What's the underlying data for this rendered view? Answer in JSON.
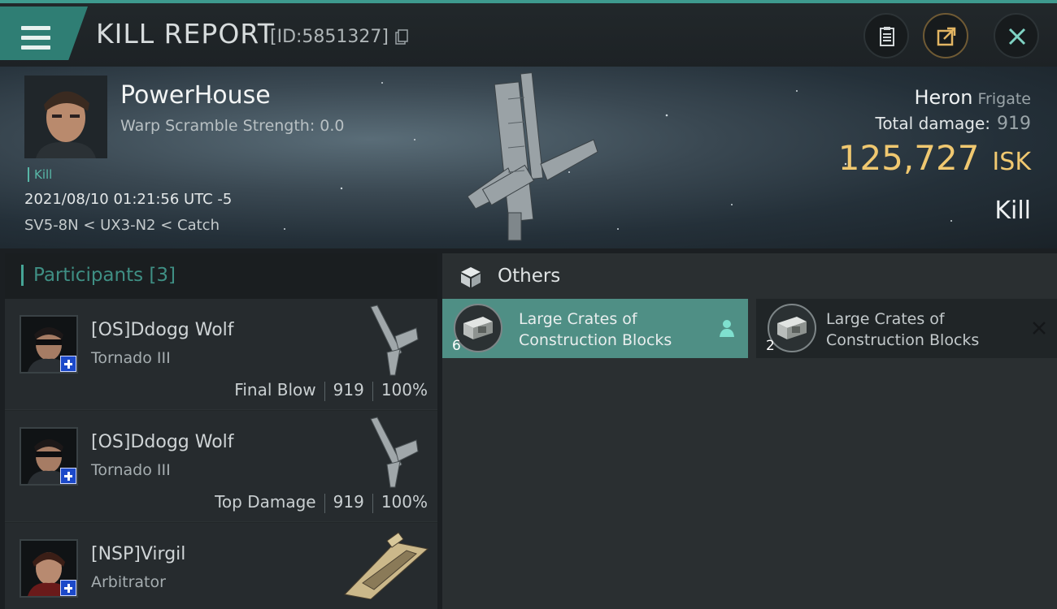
{
  "header": {
    "title": "KILL REPORT",
    "report_id": "[ID:5851327]"
  },
  "victim": {
    "name": "PowerHouse",
    "warp_scramble": "Warp Scramble Strength: 0.0",
    "tag": "Kill",
    "time": "2021/08/10 01:21:56 UTC -5",
    "location": "SV5-8N < UX3-N2 < Catch",
    "ship_name": "Heron",
    "ship_class": "Frigate",
    "total_damage_label": "Total damage:",
    "total_damage": "919",
    "isk_value": "125,727",
    "isk_unit": "ISK",
    "result": "Kill"
  },
  "participants": {
    "title": "Participants [3]",
    "rows": [
      {
        "name": "[OS]Ddogg Wolf",
        "ship": "Tornado III",
        "role": "Final Blow",
        "damage": "919",
        "percent": "100%"
      },
      {
        "name": "[OS]Ddogg Wolf",
        "ship": "Tornado III",
        "role": "Top Damage",
        "damage": "919",
        "percent": "100%"
      },
      {
        "name": "[NSP]Virgil",
        "ship": "Arbitrator"
      }
    ]
  },
  "others": {
    "title": "Others",
    "items": [
      {
        "qty": "6",
        "name_line1": "Large Crates of",
        "name_line2": "Construction Blocks"
      },
      {
        "qty": "2",
        "name_line1": "Large Crates of",
        "name_line2": "Construction Blocks"
      }
    ]
  },
  "colors": {
    "accent": "#3e9a8e",
    "isk": "#f0c870",
    "selected_item": "#4f8f85"
  },
  "icons": [
    "menu-icon",
    "copy-icon",
    "clipboard-icon",
    "share-icon",
    "close-icon",
    "box-icon",
    "person-icon",
    "close-x-icon"
  ]
}
